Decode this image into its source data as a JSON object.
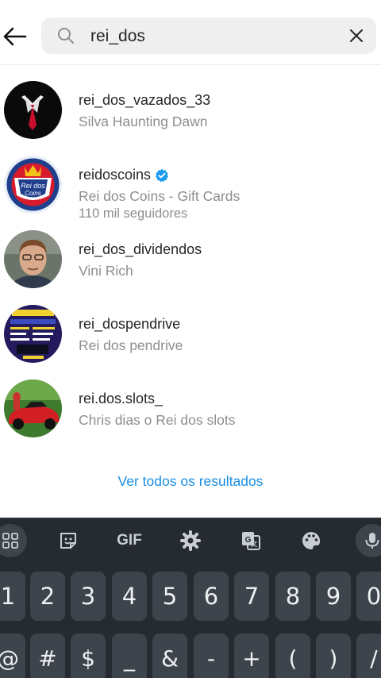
{
  "search": {
    "query": "rei_dos"
  },
  "results": [
    {
      "username": "rei_dos_vazados_33",
      "line1": "Silva Haunting Dawn",
      "line2": "",
      "verified": false
    },
    {
      "username": "reidoscoins",
      "line1": "Rei dos Coins - Gift Cards",
      "line2": "110 mil seguidores",
      "verified": true,
      "avatar_text1": "Rei dos",
      "avatar_text2": "Coins"
    },
    {
      "username": "rei_dos_dividendos",
      "line1": "Vini Rich",
      "line2": "",
      "verified": false
    },
    {
      "username": "rei_dospendrive",
      "line1": "Rei dos pendrive",
      "line2": "",
      "verified": false
    },
    {
      "username": "rei.dos.slots_",
      "line1": "Chris dias o Rei dos slots",
      "line2": "",
      "verified": false
    }
  ],
  "see_all": "Ver todos os resultados",
  "keyboard": {
    "toolbar": [
      "grid-icon",
      "sticker-icon",
      "GIF",
      "gear-icon",
      "translate-icon",
      "palette-icon",
      "mic-icon"
    ],
    "gif_label": "GIF",
    "row1": [
      "1",
      "2",
      "3",
      "4",
      "5",
      "6",
      "7",
      "8",
      "9",
      "0"
    ],
    "row2": [
      "@",
      "#",
      "$",
      "_",
      "&",
      "-",
      "+",
      "(",
      ")",
      "/"
    ]
  },
  "colors": {
    "link": "#1a8fe3",
    "keyboard_bg": "#252b31",
    "key_bg": "#3d444c",
    "verified": "#1d9bf0"
  }
}
